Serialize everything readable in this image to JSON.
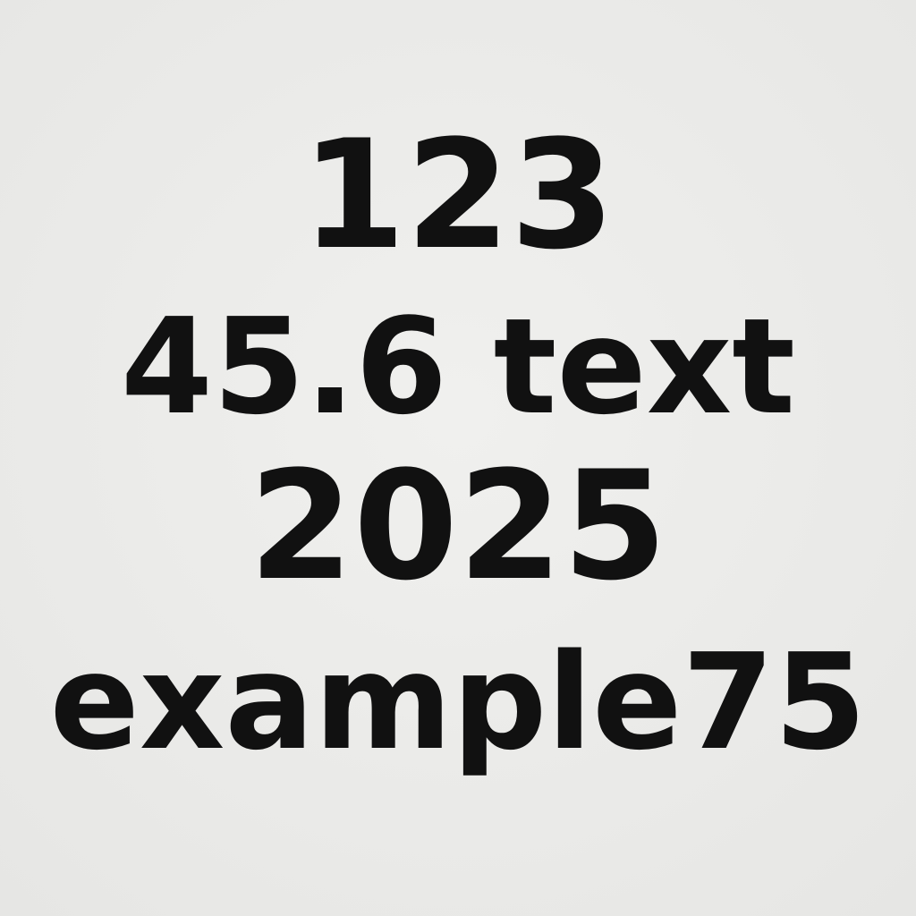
{
  "lines": {
    "line1": "123",
    "line2": "45.6 text",
    "line3": "2025",
    "line4": "example75"
  },
  "colors": {
    "background": "#ececea",
    "text": "#111111"
  }
}
